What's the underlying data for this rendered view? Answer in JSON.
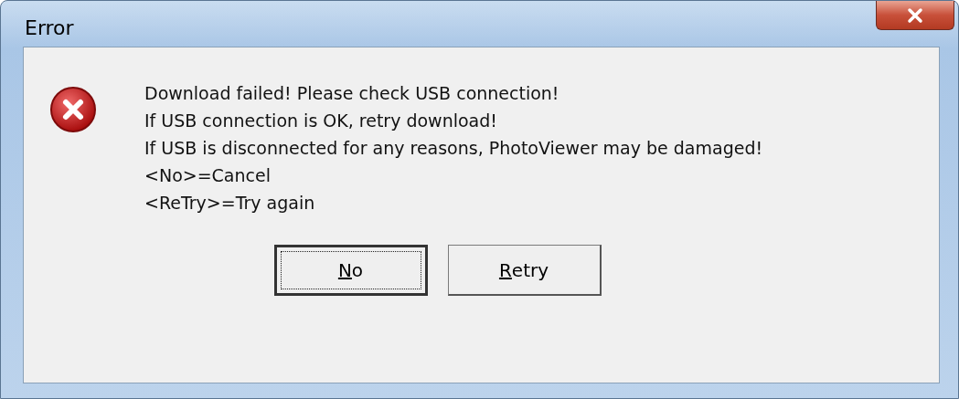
{
  "window": {
    "title": "Error"
  },
  "message_lines": [
    "Download failed! Please check USB connection!",
    "If USB connection is OK, retry download!",
    "If USB is disconnected for any reasons, PhotoViewer may be damaged!",
    "<No>=Cancel",
    "<ReTry>=Try again"
  ],
  "buttons": [
    {
      "label": "No",
      "focused": true
    },
    {
      "label": "Retry",
      "focused": false
    }
  ]
}
